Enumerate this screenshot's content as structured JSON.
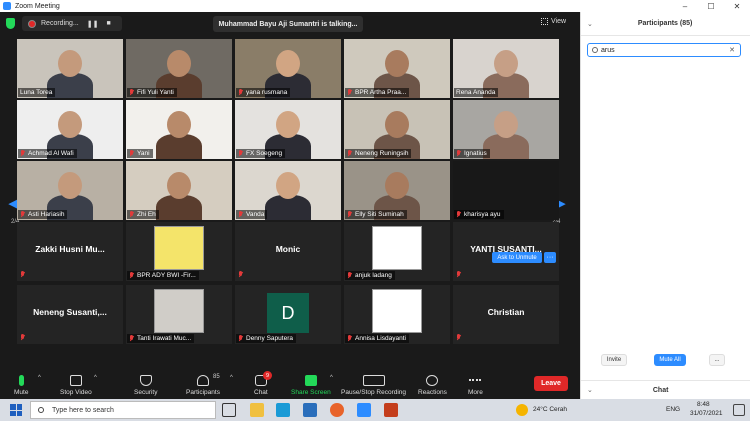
{
  "window": {
    "title": "Zoom Meeting",
    "controls": [
      "–",
      "☐",
      "✕"
    ]
  },
  "topbar": {
    "recording_label": "Recording...",
    "pause_icon": "❚❚",
    "stop_icon": "■",
    "talking": "Muhammad Bayu Aji Sumantri is talking...",
    "view_label": "View"
  },
  "nav": {
    "left_page": "2/4",
    "right_page": "2/4"
  },
  "tiles": [
    {
      "name": "Luna Torea",
      "muted": false,
      "type": "video",
      "bg": "#c9c4bb"
    },
    {
      "name": "Fifi Yuli Yanti",
      "muted": true,
      "type": "video",
      "bg": "#6f6a63"
    },
    {
      "name": "yana rusmana",
      "muted": true,
      "type": "video",
      "bg": "#8a7d68"
    },
    {
      "name": "BPR Artha Praa...",
      "muted": true,
      "type": "video",
      "bg": "#cfc9bd"
    },
    {
      "name": "Rena Ananda",
      "muted": false,
      "type": "video",
      "bg": "#d8d3ce"
    },
    {
      "name": "Achmad Al Wafi",
      "muted": true,
      "type": "video",
      "bg": "#eeeeee"
    },
    {
      "name": "Yani",
      "muted": true,
      "type": "video",
      "bg": "#f2f0ec"
    },
    {
      "name": "FX Soegeng",
      "muted": true,
      "type": "video",
      "bg": "#e4e2df"
    },
    {
      "name": "Neneng Runingsih",
      "muted": true,
      "type": "video",
      "bg": "#c8c2b6"
    },
    {
      "name": "Ignatius",
      "muted": true,
      "type": "video",
      "bg": "#a8a6a2"
    },
    {
      "name": "Asti Hariasih",
      "muted": true,
      "type": "video",
      "bg": "#b8b0a4"
    },
    {
      "name": "Zhi Eh",
      "muted": true,
      "type": "video",
      "bg": "#d5cdc0"
    },
    {
      "name": "Vanda",
      "muted": true,
      "type": "video",
      "bg": "#dcd7cf"
    },
    {
      "name": "Elly Siti Suminah",
      "muted": true,
      "type": "video",
      "bg": "#9a9388"
    },
    {
      "name": "kharisya ayu",
      "muted": true,
      "type": "blank",
      "bg": "#181818"
    },
    {
      "name": "",
      "muted": true,
      "type": "bigname",
      "display": "Zakki Husni Mu...",
      "bg": "#242424"
    },
    {
      "name": "BPR ADY BWI -Fir...",
      "muted": true,
      "type": "image",
      "bg": "#f4e46a"
    },
    {
      "name": "",
      "muted": true,
      "type": "bigname",
      "display": "Monic",
      "bg": "#242424"
    },
    {
      "name": "anjuk ladang",
      "muted": true,
      "type": "image",
      "bg": "#ffffff"
    },
    {
      "name": "",
      "muted": true,
      "type": "bigname",
      "display": "YANTI SUSANTI...",
      "bg": "#242424"
    },
    {
      "name": "",
      "muted": true,
      "type": "bigname",
      "display": "Neneng Susanti,...",
      "bg": "#242424"
    },
    {
      "name": "Tanti Irawati Muc...",
      "muted": true,
      "type": "image",
      "bg": "#d0cdc8"
    },
    {
      "name": "Denny Saputera",
      "muted": true,
      "type": "letter",
      "letter": "D",
      "bg": "#242424"
    },
    {
      "name": "Annisa Lisdayanti",
      "muted": true,
      "type": "image",
      "bg": "#ffffff"
    },
    {
      "name": "",
      "muted": true,
      "type": "bigname",
      "display": "Christian",
      "bg": "#242424"
    }
  ],
  "tile_actions": {
    "ask_unmute": "Ask to Unmute",
    "more": "···"
  },
  "toolbar": {
    "mute": "Mute",
    "stop_video": "Stop Video",
    "security": "Security",
    "participants": "Participants",
    "participants_count": "85",
    "chat": "Chat",
    "chat_badge": "9",
    "share_screen": "Share Screen",
    "pause_recording": "Pause/Stop Recording",
    "reactions": "Reactions",
    "more": "More",
    "leave": "Leave",
    "caret": "^"
  },
  "panel": {
    "title": "Participants (85)",
    "collapse": "⌄",
    "search_value": "arus",
    "search_clear": "✕",
    "invite": "Invite",
    "mute_all": "Mute All",
    "more": "...",
    "chat_title": "Chat"
  },
  "taskbar": {
    "search_placeholder": "Type here to search",
    "weather": "24°C  Cerah",
    "language": "ENG",
    "time": "8:48",
    "date": "31/07/2021"
  },
  "colors": {
    "accent": "#2D8CFF",
    "danger": "#e02828",
    "share": "#23d959"
  }
}
